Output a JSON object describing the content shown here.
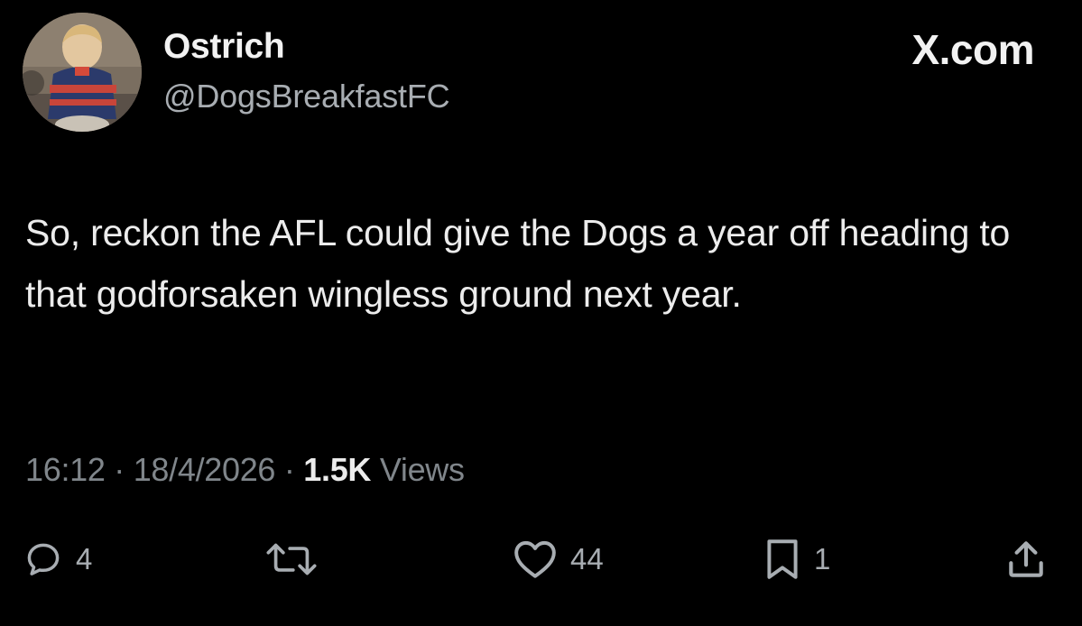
{
  "author": {
    "display_name": "Ostrich",
    "handle": "@DogsBreakfastFC",
    "avatar_icon": "profile-photo"
  },
  "brand": "X.com",
  "tweet": {
    "text": "So, reckon the AFL could give the Dogs a year off heading to that godforsaken wingless ground next year."
  },
  "meta": {
    "time": "16:12",
    "date": "18/4/2026",
    "separator": "·",
    "views_count": "1.5K",
    "views_label": "Views"
  },
  "actions": {
    "reply": {
      "icon": "reply-icon",
      "count": "4"
    },
    "retweet": {
      "icon": "retweet-icon",
      "count": ""
    },
    "like": {
      "icon": "heart-icon",
      "count": "44"
    },
    "bookmark": {
      "icon": "bookmark-icon",
      "count": "1"
    },
    "share": {
      "icon": "share-icon",
      "count": ""
    }
  },
  "colors": {
    "background": "#000000",
    "primary_text": "#e7e9ea",
    "secondary_text": "#80868b"
  }
}
